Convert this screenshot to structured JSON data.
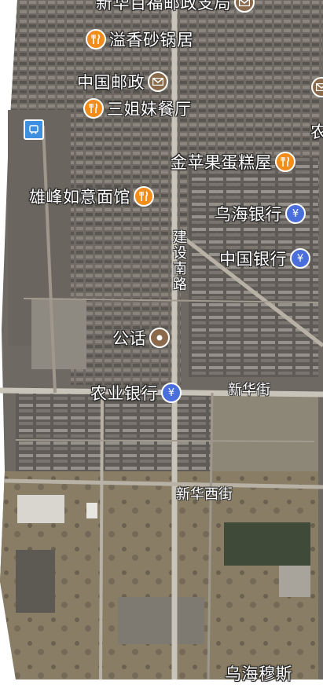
{
  "map": {
    "colors": {
      "food": "#f28c1b",
      "bank": "#4a6fdc",
      "post": "#8a6a4a",
      "public": "#8a6a4a"
    },
    "pois": [
      {
        "label": "新华百福邮政支局",
        "icon": "post-icon"
      },
      {
        "label": "溢香砂锅居",
        "icon": "restaurant-icon"
      },
      {
        "label": "中国邮政",
        "icon": "post-icon"
      },
      {
        "label": "三姐妹餐厅",
        "icon": "restaurant-icon"
      },
      {
        "label": "金苹果蛋糕屋",
        "icon": "restaurant-icon"
      },
      {
        "label": "雄峰如意面馆",
        "icon": "restaurant-icon"
      },
      {
        "label": "乌海银行",
        "icon": "bank-icon"
      },
      {
        "label": "中国银行",
        "icon": "bank-icon"
      },
      {
        "label": "公话",
        "icon": "phone-icon"
      },
      {
        "label": "农业银行",
        "icon": "bank-icon"
      },
      {
        "label": "乌海穆斯",
        "icon": "none"
      }
    ],
    "streets": {
      "jianshe_nan_lu": "建设南路",
      "xinhua_jie": "新华街",
      "xinhua_xi_jie": "新华西街"
    },
    "partial_right": "农"
  }
}
